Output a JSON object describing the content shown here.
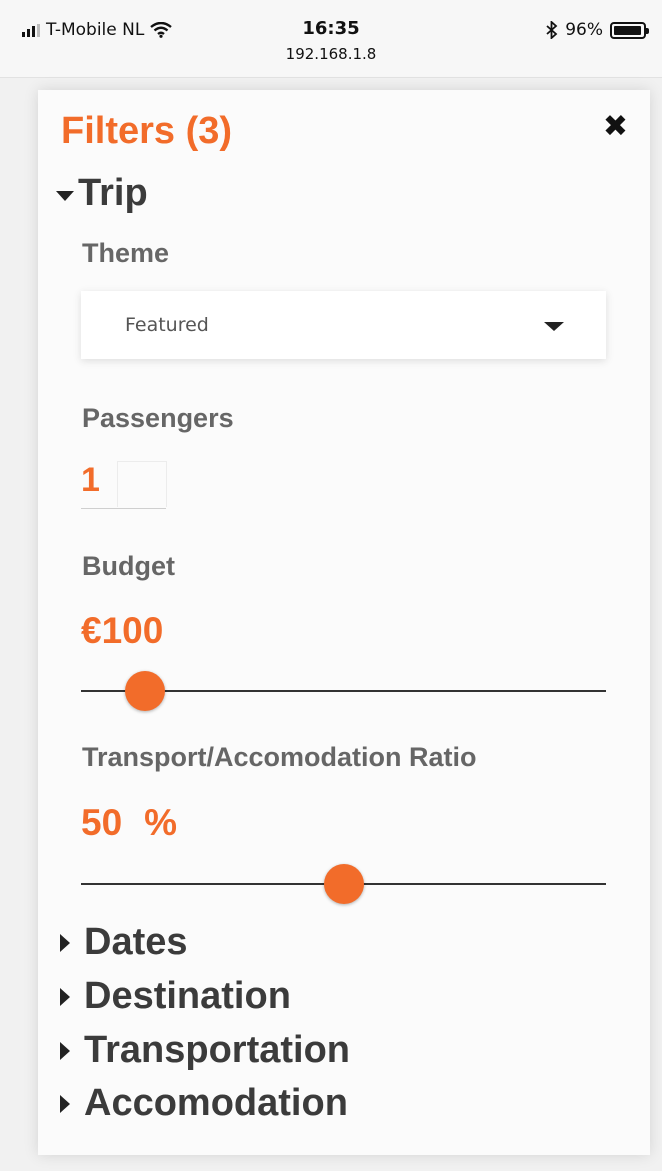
{
  "status_bar": {
    "carrier": "T-Mobile NL",
    "time": "16:35",
    "url": "192.168.1.8",
    "battery": "96%",
    "battery_level": 0.96,
    "icons": [
      "signal-icon",
      "wifi-icon",
      "bluetooth-icon",
      "battery-icon"
    ]
  },
  "panel": {
    "title": "Filters (3)",
    "close_symbol": "✖",
    "sections": {
      "trip": {
        "label": "Trip",
        "expanded": true,
        "theme": {
          "label": "Theme",
          "selected": "Featured"
        },
        "passengers": {
          "label": "Passengers",
          "value": "1"
        },
        "budget": {
          "label": "Budget",
          "value": "€100",
          "slider_fraction": 0.09
        },
        "ratio": {
          "label": "Transport/Accomodation Ratio",
          "value": "50",
          "unit": "%",
          "slider_fraction": 0.5
        }
      },
      "dates": {
        "label": "Dates",
        "expanded": false
      },
      "destination": {
        "label": "Destination",
        "expanded": false
      },
      "transportation": {
        "label": "Transportation",
        "expanded": false
      },
      "accomodation": {
        "label": "Accomodation",
        "expanded": false
      }
    }
  },
  "colors": {
    "accent": "#f26c2a",
    "heading": "#3b3b3b",
    "label": "#666666"
  }
}
